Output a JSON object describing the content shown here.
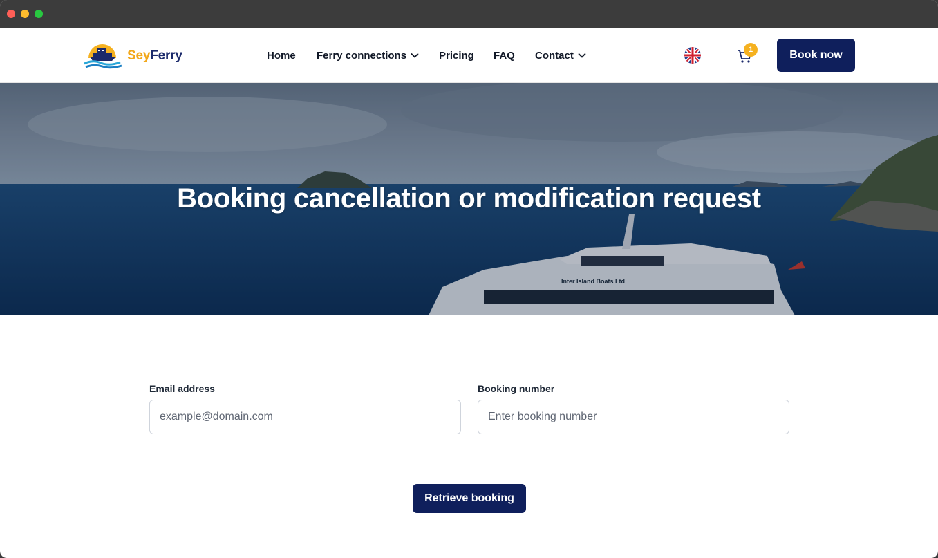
{
  "brand": {
    "name_part1": "Sey",
    "name_part2": "Ferry",
    "colors": {
      "primary": "#0f1f5c",
      "accent": "#f2a81c",
      "navy": "#1b2a6b"
    }
  },
  "nav": {
    "items": [
      {
        "label": "Home",
        "has_dropdown": false
      },
      {
        "label": "Ferry connections",
        "has_dropdown": true
      },
      {
        "label": "Pricing",
        "has_dropdown": false
      },
      {
        "label": "FAQ",
        "has_dropdown": false
      },
      {
        "label": "Contact",
        "has_dropdown": true
      }
    ],
    "language_icon": "uk-flag-icon",
    "cart_icon": "shopping-cart-icon",
    "cart_count": "1",
    "book_now_label": "Book now"
  },
  "hero": {
    "title": "Booking cancellation or modification request",
    "boat_text": "Inter Island Boats Ltd"
  },
  "form": {
    "email_label": "Email address",
    "email_placeholder": "example@domain.com",
    "email_value": "",
    "booking_label": "Booking number",
    "booking_placeholder": "Enter booking number",
    "booking_value": "",
    "submit_label": "Retrieve booking"
  }
}
